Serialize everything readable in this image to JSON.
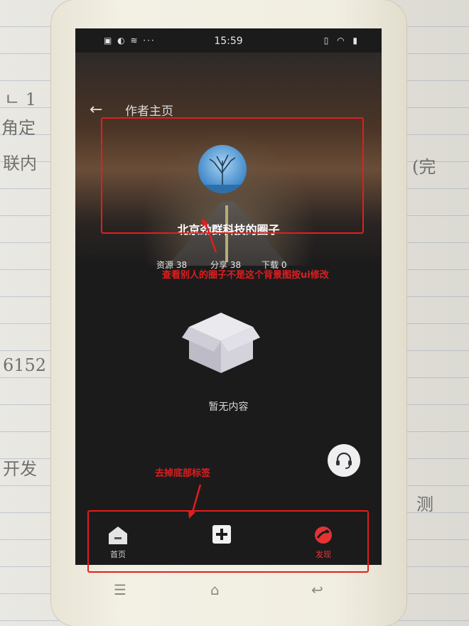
{
  "status_bar": {
    "time": "15:59"
  },
  "header": {
    "title": "作者主页"
  },
  "profile": {
    "name": "北京劲群科技的圈子",
    "stats": [
      {
        "label": "资源",
        "value": "38"
      },
      {
        "label": "分享",
        "value": "38"
      },
      {
        "label": "下载",
        "value": "0"
      }
    ]
  },
  "empty_state": {
    "message": "暂无内容"
  },
  "tab_bar": {
    "items": [
      {
        "label": "首页",
        "icon": "home-icon"
      },
      {
        "label": "",
        "icon": "plus-icon"
      },
      {
        "label": "发现",
        "icon": "discover-icon"
      }
    ]
  },
  "annotations": {
    "profile_note": "查看别人的圈子不是这个背景图按ui修改",
    "tabbar_note": "去掉底部标签"
  },
  "colors": {
    "annotation_red": "#e21d1d",
    "active_tab": "#e33333",
    "screen_bg": "#1b1b1c"
  }
}
